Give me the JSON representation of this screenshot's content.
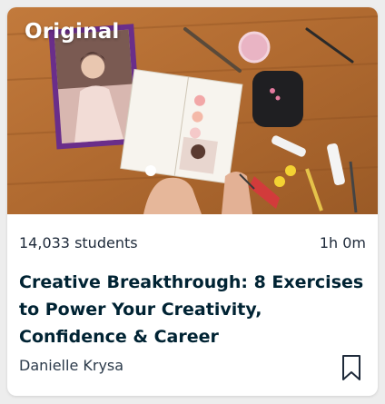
{
  "card": {
    "badge_label": "Original",
    "students_label": "14,033 students",
    "duration_label": "1h 0m",
    "title": "Creative Breakthrough: 8 Exercises to Power Your Creativity, Confidence & Career",
    "teacher_name": "Danielle Krysa"
  },
  "colors": {
    "title": "#002333",
    "accent_brand": "#00ff84",
    "background": "#ededed",
    "card": "#ffffff"
  },
  "icons": {
    "save": "bookmark-outline-icon"
  }
}
